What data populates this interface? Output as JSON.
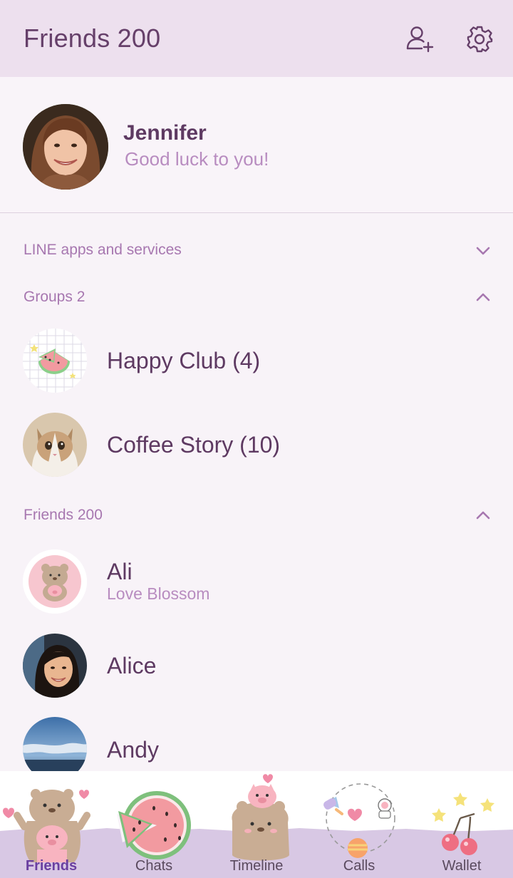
{
  "header": {
    "title": "Friends 200",
    "add_friend_icon": "add-friend-icon",
    "settings_icon": "gear-icon"
  },
  "profile": {
    "name": "Jennifer",
    "status": "Good luck to you!"
  },
  "sections": {
    "line_apps": {
      "label": "LINE apps and services",
      "state": "collapsed"
    },
    "groups": {
      "label": "Groups 2",
      "state": "expanded"
    },
    "friends": {
      "label": "Friends 200",
      "state": "expanded"
    }
  },
  "groups": [
    {
      "name": "Happy Club (4)"
    },
    {
      "name": "Coffee Story (10)"
    }
  ],
  "friends": [
    {
      "name": "Ali",
      "status": "Love Blossom"
    },
    {
      "name": "Alice"
    },
    {
      "name": "Andy"
    }
  ],
  "nav": [
    {
      "label": "Friends",
      "active": true
    },
    {
      "label": "Chats"
    },
    {
      "label": "Timeline"
    },
    {
      "label": "Calls"
    },
    {
      "label": "Wallet"
    }
  ],
  "colors": {
    "header_bg": "#ede0ee",
    "body_bg": "#f8f3f8",
    "primary_text": "#5e3a62",
    "secondary_text": "#b88cc0",
    "section_label": "#a777b0",
    "nav_band": "#d8c8e4"
  }
}
